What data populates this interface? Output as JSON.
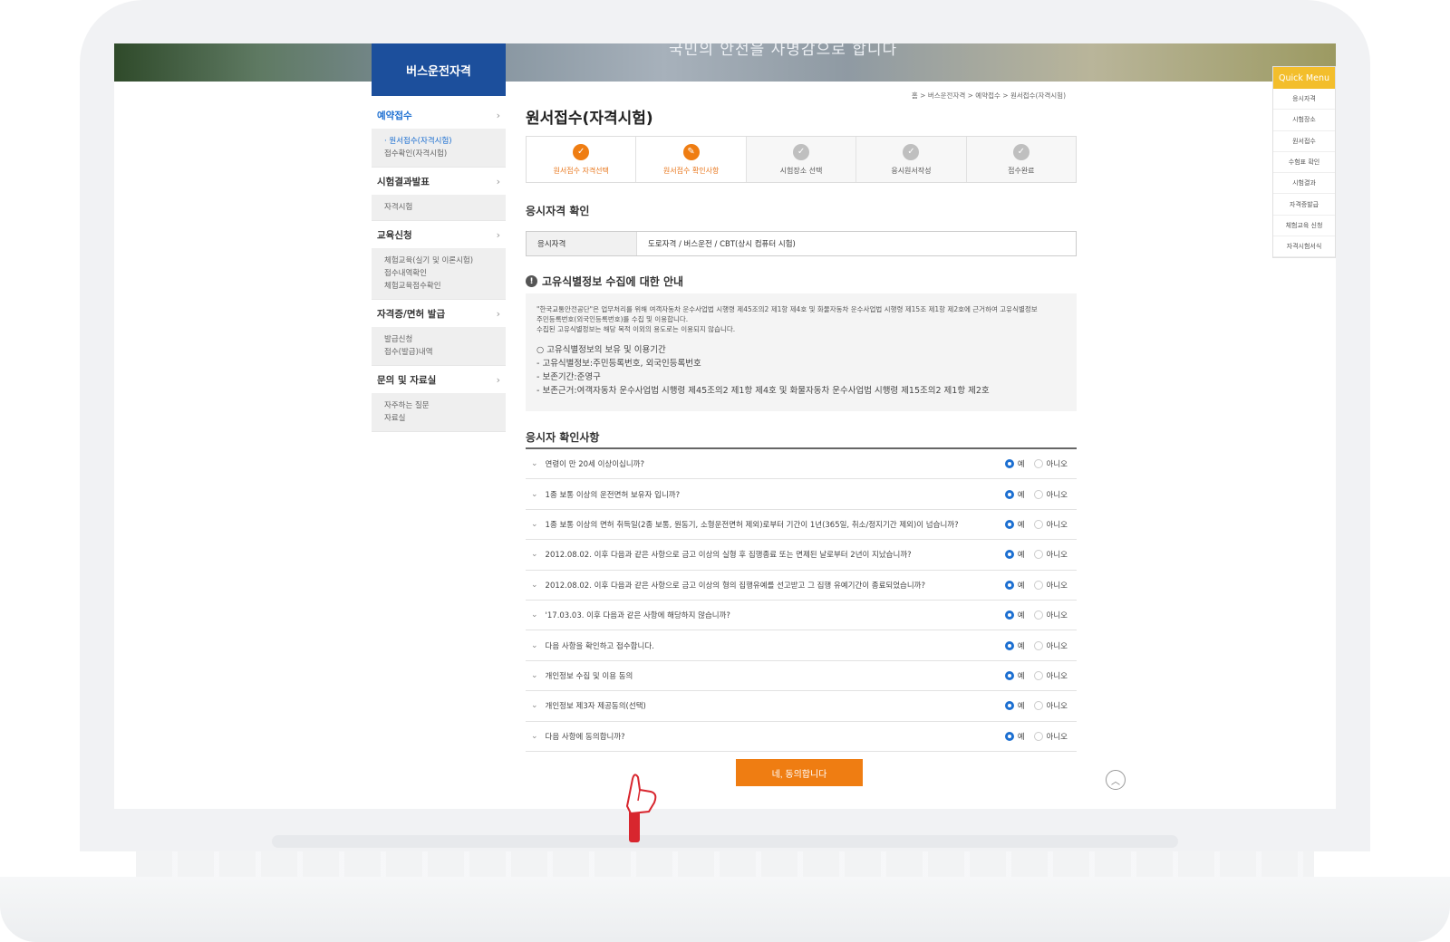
{
  "banner": {
    "slogan": "국민의 안전을 사명감으로 합니다",
    "site_title": "버스운전자격"
  },
  "sidenav": {
    "sections": [
      {
        "label": "예약접수",
        "sub": [
          "· 원서접수(자격시험)",
          "접수확인(자격시험)"
        ]
      },
      {
        "label": "시험결과발표",
        "sub": [
          "자격시험"
        ]
      },
      {
        "label": "교육신청",
        "sub": [
          "체험교육(실기 및 이론시험)",
          "접수내역확인",
          "체험교육점수확인"
        ]
      },
      {
        "label": "자격증/면허 발급",
        "sub": [
          "발급신청",
          "접수(발급)내역"
        ]
      },
      {
        "label": "문의 및 자료실",
        "sub": [
          "자주하는 질문",
          "자료실"
        ]
      }
    ]
  },
  "breadcrumb": "홈 > 버스운전자격 > 예약접수 > 원서접수(자격시험)",
  "page_title": "원서접수(자격시험)",
  "steps": [
    {
      "label": "원서접수 자격선택",
      "state": "done",
      "icon": "check-icon"
    },
    {
      "label": "원서접수 확인사항",
      "state": "current",
      "icon": "pencil-icon"
    },
    {
      "label": "시험장소 선택",
      "state": "todo",
      "icon": "check-icon"
    },
    {
      "label": "응시원서작성",
      "state": "todo",
      "icon": "check-icon"
    },
    {
      "label": "접수완료",
      "state": "todo",
      "icon": "check-icon"
    }
  ],
  "qualification": {
    "section_title": "응시자격 확인",
    "label": "응시자격",
    "value": "도로자격 / 버스운전 / CBT(상시 컴퓨터 시험)"
  },
  "notice": {
    "title": "고유식별정보 수집에 대한 안내",
    "line1": "\"한국교통안전공단\"은 업무처리를 위해 여객자동차 운수사업법 시행령 제45조의2 제1항 제4호 및 화물자동차 운수사업법 시행령 제15조 제1항 제2호에 근거하여 고유식별정보",
    "line2": "주민등록번호(외국인등록번호)를 수집 및 이용합니다.",
    "line3": "수집된 고유식별정보는 해당 목적 이외의 용도로는 이용되지 않습니다.",
    "list_head": "○ 고유식별정보의 보유 및 이용기간",
    "item1": "- 고유식별정보:주민등록번호, 외국인등록번호",
    "item2": "- 보존기간:준영구",
    "item3": "- 보존근거:여객자동차 운수사업법 시행령 제45조의2 제1항 제4호 및 화물자동차 운수사업법 시행령 제15조의2 제1항 제2호"
  },
  "checklist": {
    "title": "응시자 확인사항",
    "yes_label": "예",
    "no_label": "아니오",
    "items": [
      "연령이 만 20세 이상이십니까?",
      "1종 보통 이상의 운전면허 보유자 입니까?",
      "1종 보통 이상의 면허 취득일(2종 보통, 원동기, 소형운전면허 제외)로부터 기간이 1년(365일, 취소/정지기간 제외)이 넘습니까?",
      "2012.08.02. 이후 다음과 같은 사항으로 금고 이상의 실형 후 집행종료 또는 면제된 날로부터 2년이 지났습니까?",
      "2012.08.02. 이후 다음과 같은 사항으로 금고 이상의 형의 집행유예를 선고받고 그 집행 유예기간이 종료되었습니까?",
      "'17.03.03. 이후 다음과 같은 사항에 해당하지 않습니까?",
      "다음 사항을 확인하고 접수합니다.",
      "개인정보 수집 및 이용 동의",
      "개인정보 제3자 제공동의(선택)",
      "다음 사항에 동의합니까?"
    ]
  },
  "agree_button": "네, 동의합니다",
  "quick_menu": {
    "title": "Quick Menu",
    "items": [
      "응시자격",
      "시험장소",
      "원서접수",
      "수험표 확인",
      "시험결과",
      "자격증발급",
      "체험교육 신청",
      "자격시험서식"
    ]
  },
  "colors": {
    "brand_blue": "#1c4f9c",
    "accent_orange": "#ef7d12",
    "quick_yellow": "#f3be2c"
  }
}
